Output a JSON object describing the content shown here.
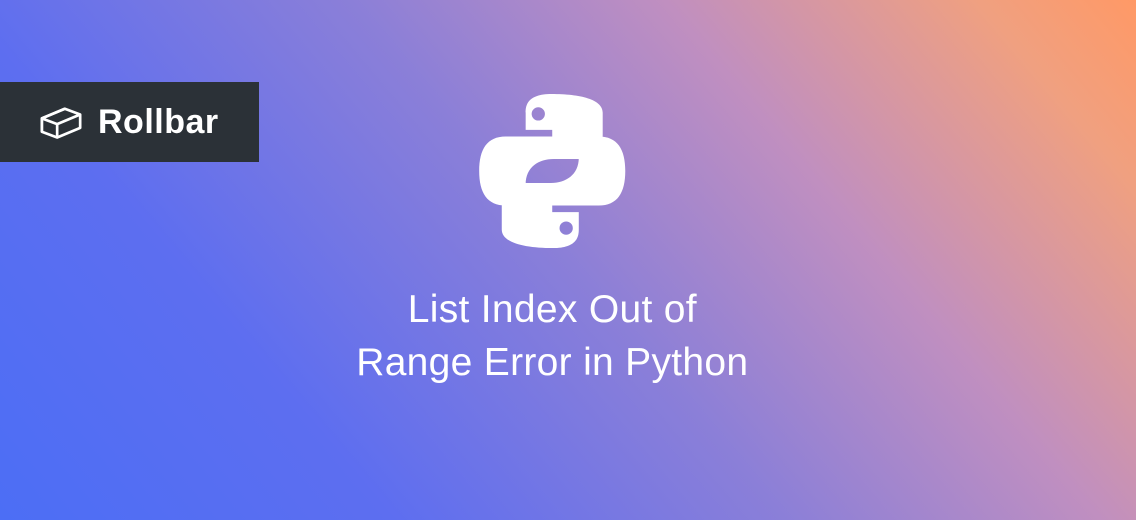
{
  "logo": {
    "brand_name": "Rollbar"
  },
  "main": {
    "title_line1": "List Index Out of",
    "title_line2": "Range Error in Python"
  }
}
